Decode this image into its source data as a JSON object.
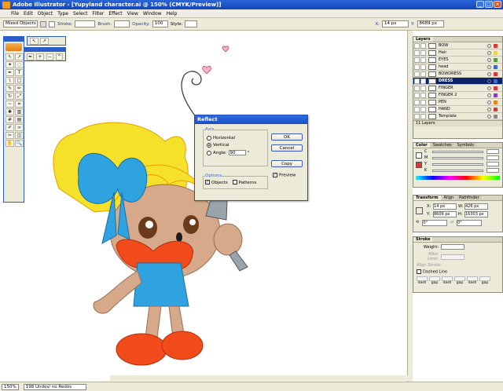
{
  "window": {
    "title": "Adobe Illustrator - [Yupyland character.ai @ 150% (CMYK/Preview)]"
  },
  "menu": [
    "File",
    "Edit",
    "Object",
    "Type",
    "Select",
    "Filter",
    "Effect",
    "View",
    "Window",
    "Help"
  ],
  "control": {
    "selection": "Mixed Objects",
    "stroke_label": "Stroke:",
    "brush_label": "Brush:",
    "opacity_label": "Opacity:",
    "opacity_value": "100",
    "style_label": "Style:",
    "x_label": "X:",
    "x_value": "14 px",
    "y_label": "Y:",
    "y_value": "8689 px"
  },
  "dialog": {
    "title": "Reflect",
    "axis_legend": "Axis",
    "horizontal": "Horizontal",
    "vertical": "Vertical",
    "angle_label": "Angle:",
    "angle_value": "90",
    "angle_unit": "°",
    "options_legend": "Options",
    "objects": "Objects",
    "patterns": "Patterns",
    "ok": "OK",
    "cancel": "Cancel",
    "copy": "Copy",
    "preview": "Preview"
  },
  "layers": {
    "tab": "Layers",
    "items": [
      {
        "name": "BOW",
        "color": "#d63a3a"
      },
      {
        "name": "Hair",
        "color": "#f0d23a"
      },
      {
        "name": "EYES",
        "color": "#5a9a3a"
      },
      {
        "name": "head",
        "color": "#3a6ad6"
      },
      {
        "name": "BOWDRESS",
        "color": "#d63a3a"
      },
      {
        "name": "DRESS",
        "color": "#3a6ad6"
      },
      {
        "name": "FINGER",
        "color": "#d63a3a"
      },
      {
        "name": "FINGER 2",
        "color": "#8a3ad6"
      },
      {
        "name": "PEN",
        "color": "#e08a2a"
      },
      {
        "name": "HAND",
        "color": "#d63a3a"
      },
      {
        "name": "Template",
        "color": "#888888"
      }
    ],
    "selected": 5,
    "footer": "11 Layers"
  },
  "color_panel": {
    "tabs": [
      "Color",
      "Swatches",
      "Symbols"
    ],
    "channels": [
      "C",
      "M",
      "Y",
      "K"
    ]
  },
  "transform_panel": {
    "tabs": [
      "Transform",
      "Align",
      "Pathfinder"
    ],
    "x_label": "X:",
    "x_value": "14 px",
    "y_label": "Y:",
    "y_value": "8609 px",
    "w_label": "W:",
    "w_value": "426 px",
    "h_label": "H:",
    "h_value": "16303 px",
    "rotate": "0°",
    "shear": "0°"
  },
  "stroke_panel": {
    "tab": "Stroke",
    "weight": "Weight:",
    "miter": "Miter Limit:",
    "align": "Align Stroke:",
    "dashed": "Dashed Line",
    "dash_labels": [
      "dash",
      "gap",
      "dash",
      "gap",
      "dash",
      "gap"
    ]
  },
  "status": {
    "zoom": "150%",
    "info": "198 Undos/ no Redos"
  }
}
